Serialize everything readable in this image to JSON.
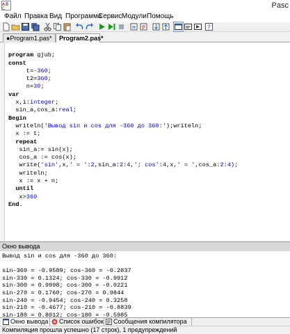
{
  "window": {
    "title": "Pasc"
  },
  "menu": [
    "Файл",
    "Правка",
    "Вид",
    "Программа",
    "Сервис",
    "Модули",
    "Помощь"
  ],
  "toolbar": {
    "icons": [
      "new-file-icon",
      "open-folder-icon",
      "save-icon",
      "save-all-icon",
      "cut-icon",
      "copy-icon",
      "paste-icon",
      "undo-icon",
      "redo-icon",
      "run-icon",
      "debug-run-icon",
      "stop-icon",
      "breakpoint-icon",
      "step-over-icon",
      "step-into-icon",
      "step-out-icon",
      "goto-cursor-icon",
      "toggle-output-icon",
      "watch-icon",
      "help-icon"
    ]
  },
  "tabs": [
    {
      "label": "●Program1.pas*",
      "active": false
    },
    {
      "label": "Program2.pas*",
      "active": true
    }
  ],
  "editor": {
    "lines": [
      "program gjub;",
      "const",
      "     t=-360;",
      "     t2=360;",
      "     n=30;",
      "var",
      "  x,i:integer;",
      "  sin_a,cos_a:real;",
      "Begin",
      "  writeln('Вывод sin и cos для -360 до 360:');writeln;",
      "  x := t;",
      "  repeat",
      "   sin_a:= sin(x);",
      "   cos_a := cos(x);",
      "   write('sin',x,' = ':2,sin_a:2:4,'; cos':4,x,' = ',cos_a:2:4);",
      "   writeln;",
      "   x := x + n;",
      "  until",
      "   x>360",
      "End."
    ]
  },
  "output": {
    "header": "Окно вывода",
    "lines": [
      "Вывод sin и cos для -360 до 360:",
      "",
      "sin-360 = -0.9589; cos-360 = -0.2837",
      "sin-330 = 0.1324; cos-330 = -0.9912",
      "sin-300 = 0.9998; cos-300 = -0.0221",
      "sin-270 = 0.1760; cos-270 = 0.9844",
      "sin-240 = -0.9454; cos-240 = 0.3258",
      "sin-210 = -0.4677; cos-210 = -0.8839",
      "sin-180 = 0.8012; cos-180 = -0.5985"
    ]
  },
  "bottom_tabs": [
    {
      "label": "Окно вывода",
      "icon": "output-window-icon"
    },
    {
      "label": "Список ошибок",
      "icon": "error-list-icon"
    },
    {
      "label": "Сообщения компилятора",
      "icon": "compiler-messages-icon"
    }
  ],
  "status": {
    "text": "Компиляция прошла успешно (17 строк), 1 предупреждений"
  },
  "colors": {
    "keyword": "#000000",
    "literal": "#0000ff",
    "output_header_bg": "#d7d7d7"
  }
}
